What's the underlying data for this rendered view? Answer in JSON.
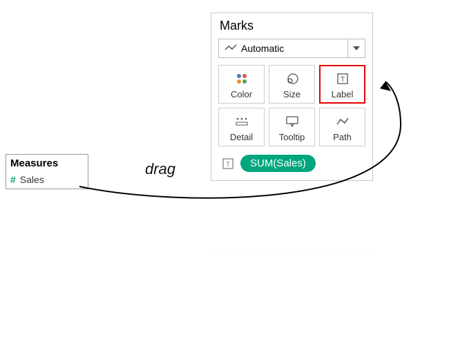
{
  "measures": {
    "title": "Measures",
    "items": [
      {
        "name": "Sales"
      }
    ]
  },
  "annotation": {
    "drag_label": "drag"
  },
  "marks": {
    "title": "Marks",
    "mark_type": {
      "label": "Automatic"
    },
    "buttons": {
      "color": "Color",
      "size": "Size",
      "label": "Label",
      "detail": "Detail",
      "tooltip": "Tooltip",
      "path": "Path"
    },
    "shelf": [
      {
        "type_icon": "label",
        "pill_text": "SUM(Sales)"
      }
    ]
  }
}
